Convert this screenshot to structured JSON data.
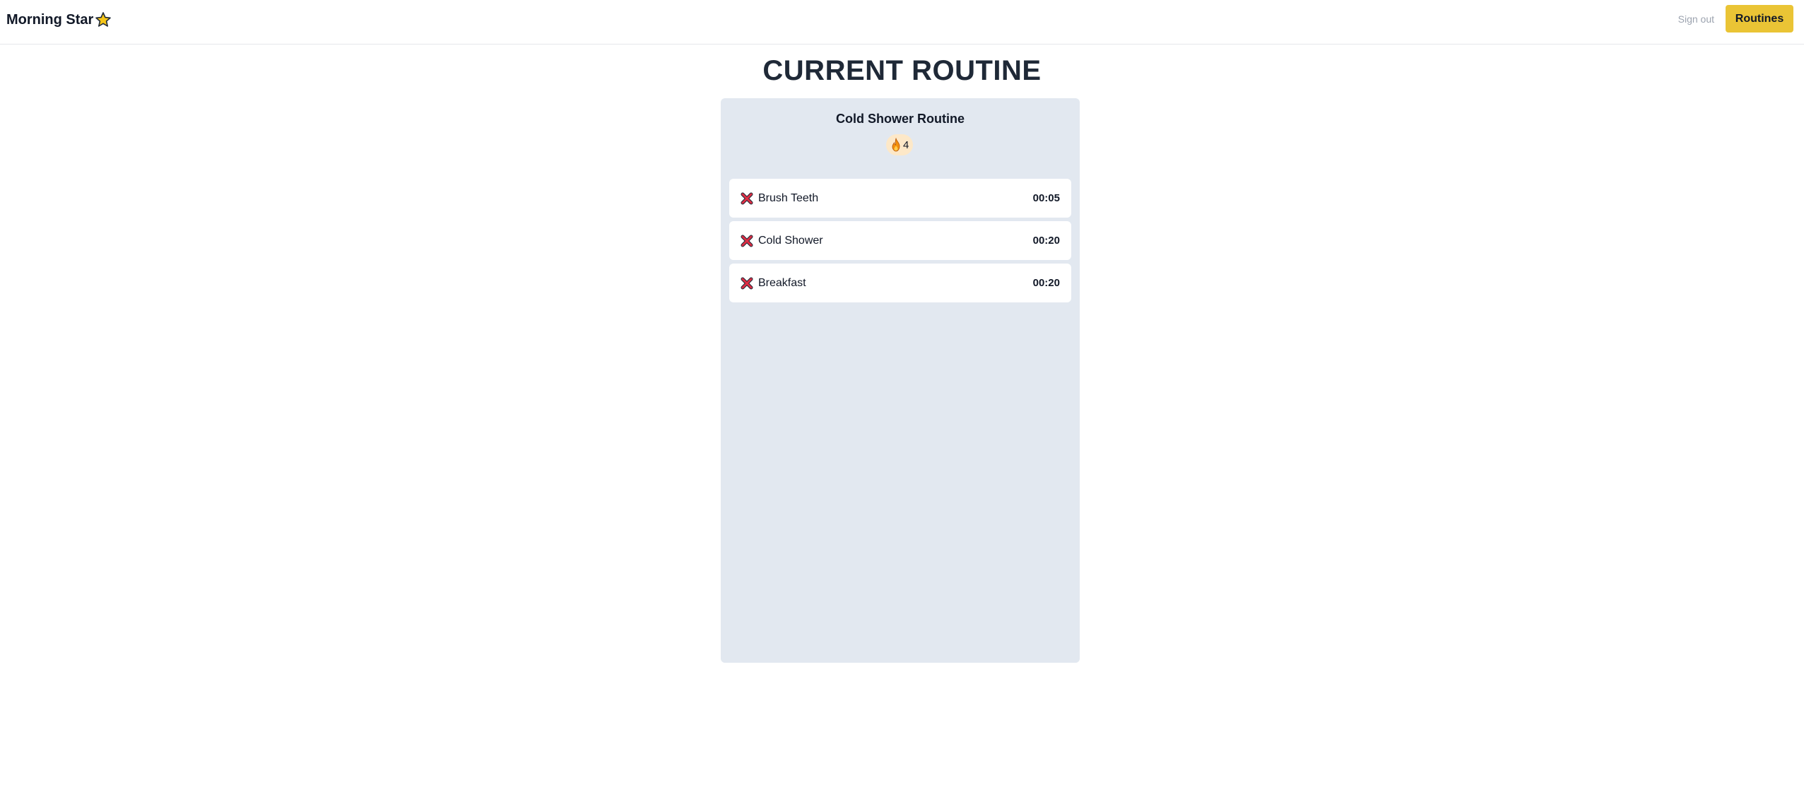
{
  "header": {
    "brand": "Morning Star",
    "brand_icon": "star-icon",
    "sign_out_label": "Sign out",
    "routines_label": "Routines",
    "accent_color": "#eac435"
  },
  "main": {
    "title": "CURRENT ROUTINE",
    "routine": {
      "name": "Cold Shower Routine",
      "streak_icon": "flame-icon",
      "streak_count": "4",
      "tasks": [
        {
          "status_icon": "x-icon",
          "name": "Brush Teeth",
          "duration": "00:05"
        },
        {
          "status_icon": "x-icon",
          "name": "Cold Shower",
          "duration": "00:20"
        },
        {
          "status_icon": "x-icon",
          "name": "Breakfast",
          "duration": "00:20"
        }
      ]
    }
  }
}
